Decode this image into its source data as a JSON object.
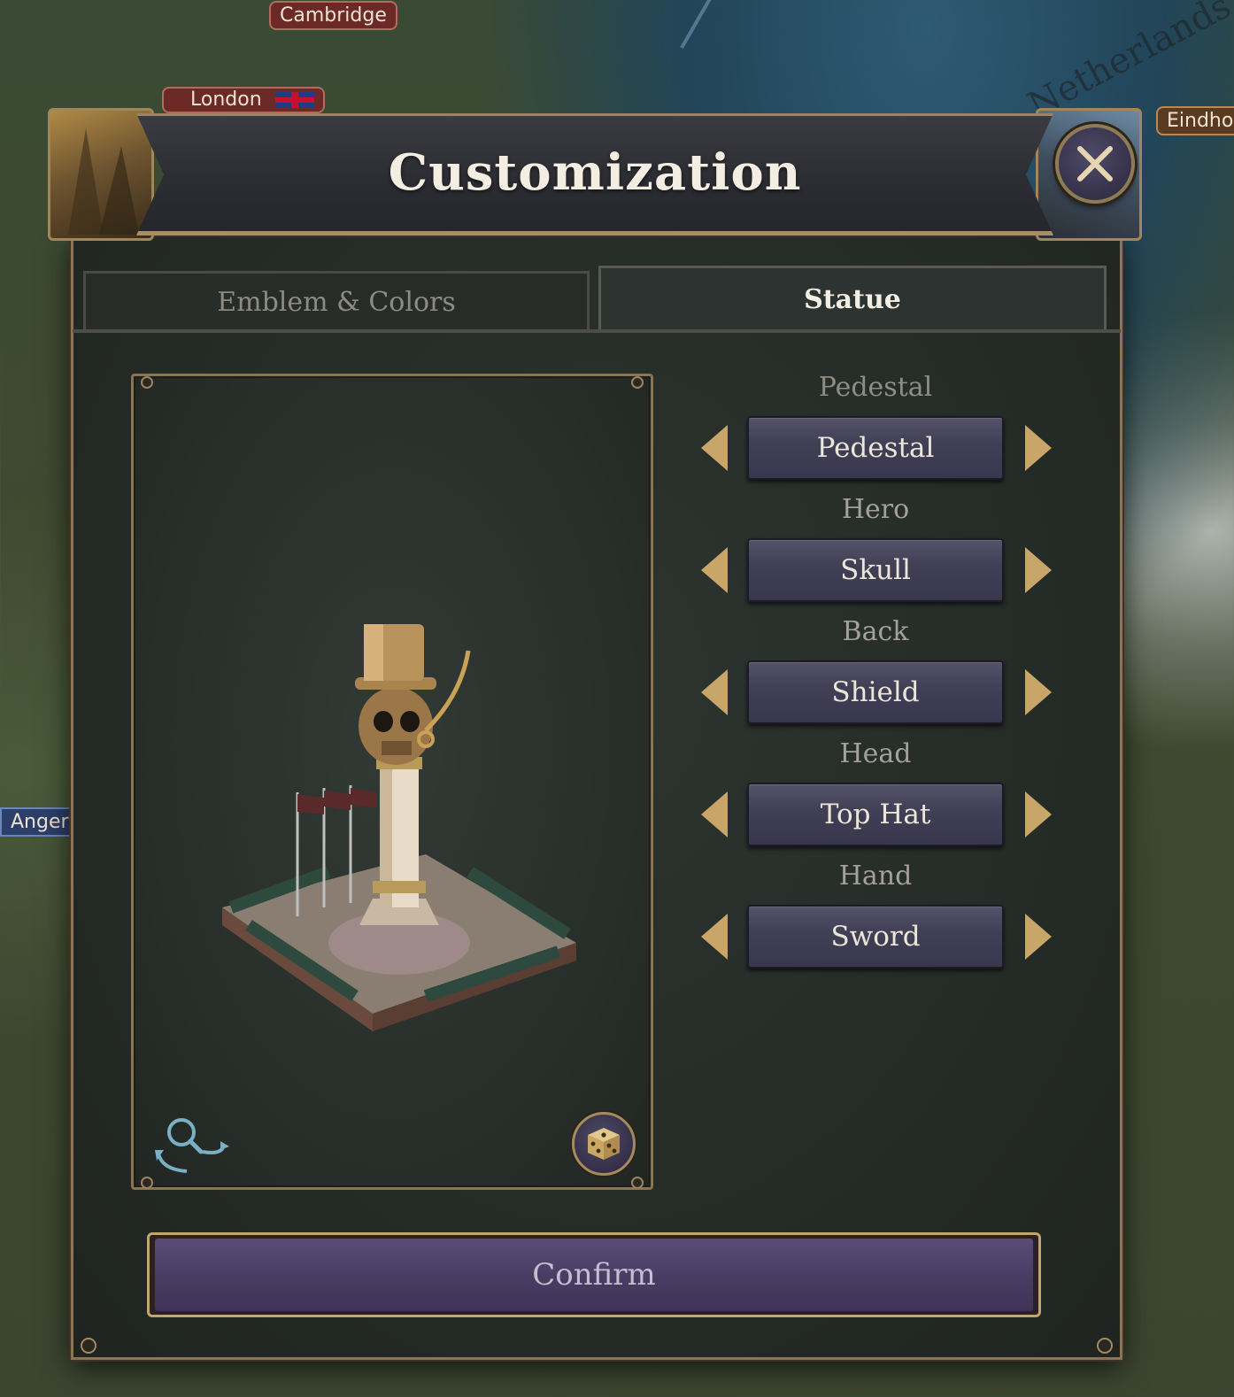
{
  "map": {
    "cities": [
      {
        "name": "Cambridge",
        "color": "#6b2a26"
      },
      {
        "name": "London",
        "color": "#6b2a26"
      },
      {
        "name": "Eindho",
        "color": "#5b3a22"
      },
      {
        "name": "Anger",
        "color": "#2c3f6a"
      }
    ],
    "region_label": "Netherlands"
  },
  "dialog": {
    "title": "Customization",
    "close_icon": "close-icon"
  },
  "tabs": [
    {
      "label": "Emblem & Colors",
      "active": false
    },
    {
      "label": "Statue",
      "active": true
    }
  ],
  "preview": {
    "rotate_zoom_icon": "rotate-zoom-icon",
    "randomize_icon": "dice-icon"
  },
  "options": [
    {
      "label": "Pedestal",
      "value": "Pedestal"
    },
    {
      "label": "Hero",
      "value": "Skull"
    },
    {
      "label": "Back",
      "value": "Shield"
    },
    {
      "label": "Head",
      "value": "Top Hat"
    },
    {
      "label": "Hand",
      "value": "Sword"
    }
  ],
  "confirm_label": "Confirm",
  "colors": {
    "gold": "#c4a56a",
    "purple": "#4a3d64",
    "panel": "#2a302c"
  }
}
